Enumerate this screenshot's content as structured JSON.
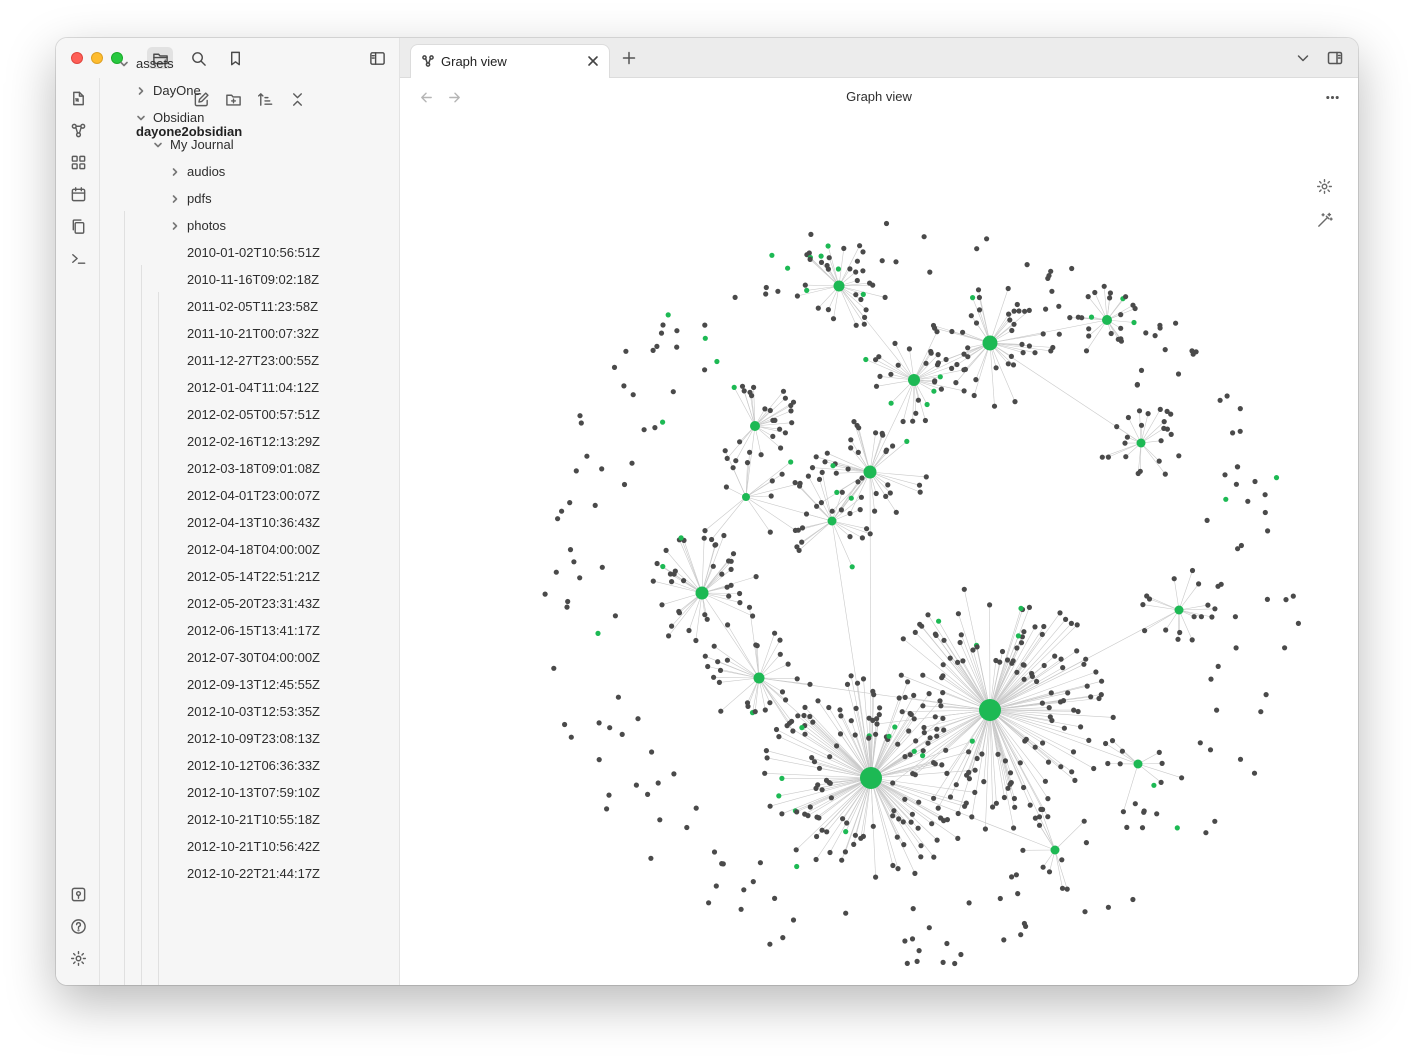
{
  "window": {
    "sidebar_top_icons": [
      "folder-icon",
      "search-icon",
      "bookmark-icon",
      "sidebar-toggle-icon"
    ]
  },
  "ribbon": {
    "top_icons": [
      "open-quick-switcher-icon",
      "graph-icon",
      "canvas-icon",
      "calendar-icon",
      "copy-icon",
      "terminal-icon"
    ],
    "bottom_icons": [
      "vault-switcher-icon",
      "help-icon",
      "settings-icon"
    ]
  },
  "sidebar": {
    "actions": [
      "new-note-icon",
      "new-folder-icon",
      "sort-icon",
      "collapse-all-icon"
    ],
    "vault_name": "dayone2obsidian",
    "tree": [
      {
        "label": "assets",
        "depth": 0,
        "chevron": "down"
      },
      {
        "label": "DayOne",
        "depth": 1,
        "chevron": "right"
      },
      {
        "label": "Obsidian",
        "depth": 1,
        "chevron": "down"
      },
      {
        "label": "My Journal",
        "depth": 2,
        "chevron": "down"
      },
      {
        "label": "audios",
        "depth": 3,
        "chevron": "right"
      },
      {
        "label": "pdfs",
        "depth": 3,
        "chevron": "right"
      },
      {
        "label": "photos",
        "depth": 3,
        "chevron": "right"
      },
      {
        "label": "2010-01-02T10:56:51Z",
        "depth": 3,
        "chevron": "none"
      },
      {
        "label": "2010-11-16T09:02:18Z",
        "depth": 3,
        "chevron": "none"
      },
      {
        "label": "2011-02-05T11:23:58Z",
        "depth": 3,
        "chevron": "none"
      },
      {
        "label": "2011-10-21T00:07:32Z",
        "depth": 3,
        "chevron": "none"
      },
      {
        "label": "2011-12-27T23:00:55Z",
        "depth": 3,
        "chevron": "none"
      },
      {
        "label": "2012-01-04T11:04:12Z",
        "depth": 3,
        "chevron": "none"
      },
      {
        "label": "2012-02-05T00:57:51Z",
        "depth": 3,
        "chevron": "none"
      },
      {
        "label": "2012-02-16T12:13:29Z",
        "depth": 3,
        "chevron": "none"
      },
      {
        "label": "2012-03-18T09:01:08Z",
        "depth": 3,
        "chevron": "none"
      },
      {
        "label": "2012-04-01T23:00:07Z",
        "depth": 3,
        "chevron": "none"
      },
      {
        "label": "2012-04-13T10:36:43Z",
        "depth": 3,
        "chevron": "none"
      },
      {
        "label": "2012-04-18T04:00:00Z",
        "depth": 3,
        "chevron": "none"
      },
      {
        "label": "2012-05-14T22:51:21Z",
        "depth": 3,
        "chevron": "none"
      },
      {
        "label": "2012-05-20T23:31:43Z",
        "depth": 3,
        "chevron": "none"
      },
      {
        "label": "2012-06-15T13:41:17Z",
        "depth": 3,
        "chevron": "none"
      },
      {
        "label": "2012-07-30T04:00:00Z",
        "depth": 3,
        "chevron": "none"
      },
      {
        "label": "2012-09-13T12:45:55Z",
        "depth": 3,
        "chevron": "none"
      },
      {
        "label": "2012-10-03T12:53:35Z",
        "depth": 3,
        "chevron": "none"
      },
      {
        "label": "2012-10-09T23:08:13Z",
        "depth": 3,
        "chevron": "none"
      },
      {
        "label": "2012-10-12T06:36:33Z",
        "depth": 3,
        "chevron": "none"
      },
      {
        "label": "2012-10-13T07:59:10Z",
        "depth": 3,
        "chevron": "none"
      },
      {
        "label": "2012-10-21T10:55:18Z",
        "depth": 3,
        "chevron": "none"
      },
      {
        "label": "2012-10-21T10:56:42Z",
        "depth": 3,
        "chevron": "none"
      },
      {
        "label": "2012-10-22T21:44:17Z",
        "depth": 3,
        "chevron": "none"
      }
    ]
  },
  "tabs": [
    {
      "label": "Graph view",
      "icon": "graph-icon",
      "active": true
    }
  ],
  "view": {
    "title": "Graph view",
    "graph_colors": {
      "node": "#4a4a4a",
      "hub_node": "#1db954",
      "edge": "#c9c9c9"
    }
  }
}
